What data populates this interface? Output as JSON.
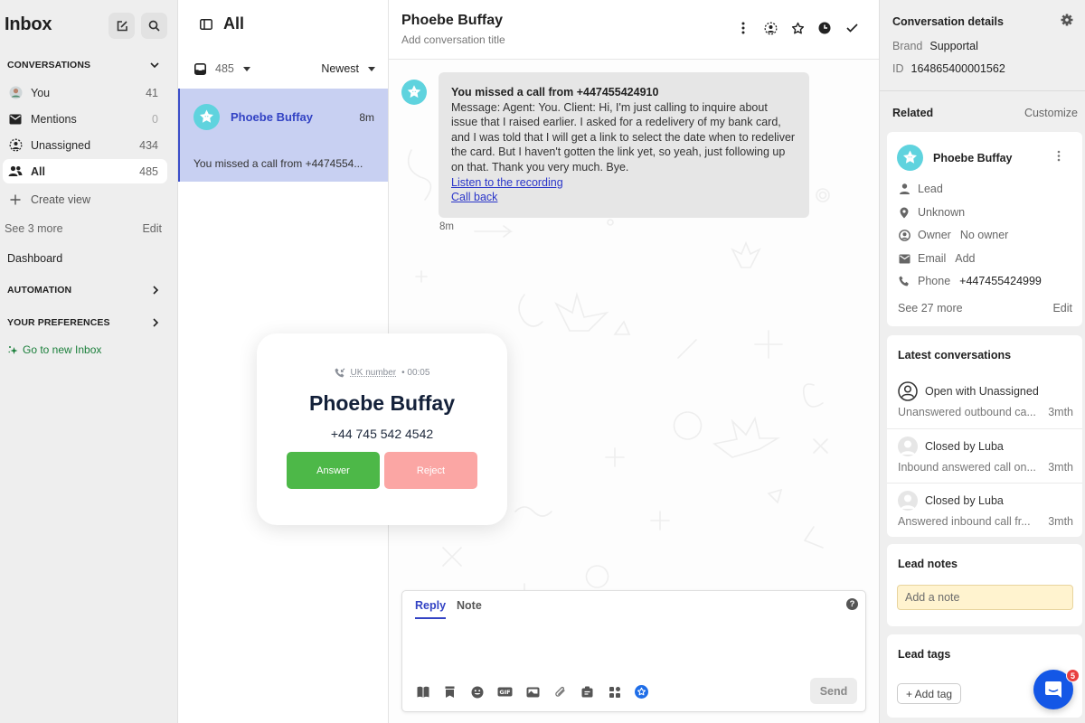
{
  "nav": {
    "title": "Inbox",
    "compose_icon": "compose-icon",
    "search_icon": "search-icon",
    "conversations_section": "CONVERSATIONS",
    "items": [
      {
        "label": "You",
        "count": "41",
        "icon": "avatar-icon"
      },
      {
        "label": "Mentions",
        "count": "0",
        "icon": "envelope-icon"
      },
      {
        "label": "Unassigned",
        "count": "434",
        "icon": "group-icon"
      },
      {
        "label": "All",
        "count": "485",
        "icon": "users-icon",
        "active": true
      }
    ],
    "create_view": "Create view",
    "see_more": "See 3 more",
    "edit": "Edit",
    "dashboard": "Dashboard",
    "automation": "AUTOMATION",
    "preferences": "YOUR PREFERENCES",
    "go_new_inbox": "Go to new Inbox"
  },
  "list": {
    "title": "All",
    "count": "485",
    "sort": "Newest",
    "conversations": [
      {
        "name": "Phoebe Buffay",
        "time": "8m",
        "preview": "You missed a call from +4474554..."
      }
    ]
  },
  "main": {
    "title": "Phoebe Buffay",
    "subtitle": "Add conversation title",
    "message": {
      "title": "You missed a call from +447455424910",
      "body": "Message: Agent: You. Client: Hi, I'm just calling to inquire about issue that I raised earlier. I asked for a redelivery of my bank card, and I was told that I will get a link to select the date when to redeliver the card. But I haven't gotten the link yet, so yeah, just following up on that. Thank you very much. Bye.",
      "link_recording": "Listen to the recording",
      "link_callback": "Call back",
      "time": "8m"
    },
    "composer": {
      "tab_reply": "Reply",
      "tab_note": "Note",
      "help": "?",
      "placeholder": "",
      "send": "Send",
      "gif": "GIF"
    }
  },
  "call": {
    "line": "UK number",
    "duration": "• 00:05",
    "name": "Phoebe Buffay",
    "phone": "+44 745 542 4542",
    "answer": "Answer",
    "reject": "Reject"
  },
  "details": {
    "title": "Conversation details",
    "brand_label": "Brand",
    "brand": "Supportal",
    "id_label": "ID",
    "id": "164865400001562",
    "related": "Related",
    "customize": "Customize",
    "contact": {
      "name": "Phoebe Buffay",
      "type": "Lead",
      "location": "Unknown",
      "owner_label": "Owner",
      "owner": "No owner",
      "email_label": "Email",
      "email": "Add",
      "phone_label": "Phone",
      "phone": "+447455424999",
      "see_more": "See 27 more",
      "edit": "Edit"
    },
    "latest": {
      "title": "Latest conversations",
      "items": [
        {
          "status": "Open with Unassigned",
          "preview": "Unanswered outbound ca...",
          "time": "3mth"
        },
        {
          "status": "Closed by Luba",
          "preview": "Inbound answered call on...",
          "time": "3mth"
        },
        {
          "status": "Closed by Luba",
          "preview": "Answered inbound call fr...",
          "time": "3mth"
        }
      ]
    },
    "notes": {
      "title": "Lead notes",
      "placeholder": "Add a note"
    },
    "tags": {
      "title": "Lead tags",
      "add": "+ Add tag"
    },
    "chat_badge": "5"
  },
  "colors": {
    "accent": "#3343c4",
    "selected_bg": "#c8d0f2",
    "answer": "#4db848",
    "reject": "#fba6a4",
    "avatar": "#5fd3de",
    "launcher": "#1457e6"
  }
}
